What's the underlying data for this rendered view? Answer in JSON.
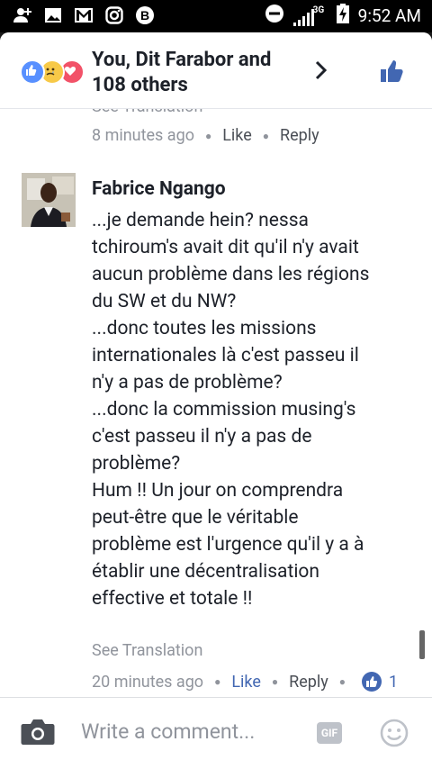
{
  "status_bar": {
    "time": "9:52 AM",
    "network_label": "3G",
    "left_icons": [
      "user-add-icon",
      "gallery-icon",
      "gmail-icon",
      "instagram-icon",
      "bitcoin-icon"
    ]
  },
  "header": {
    "title_line1": "You, Dit Farabor and",
    "title_line2": "108 others",
    "reaction_icons": [
      "like-reaction-icon",
      "sad-reaction-icon",
      "love-reaction-icon"
    ]
  },
  "previous_comment": {
    "translation_label": "See Translation",
    "time": "8 minutes ago",
    "like_label": "Like",
    "reply_label": "Reply"
  },
  "comment": {
    "author": "Fabrice Ngango",
    "lines": [
      "...je demande hein? nessa",
      "tchiroum's avait dit qu'il n'y avait",
      "aucun problème dans les régions",
      "du SW et du NW?",
      "...donc toutes les missions",
      "internationales là c'est passeu il",
      "n'y a pas de problème?",
      "...donc la commission musing's",
      "c'est passeu il n'y a pas de",
      "problème?",
      "Hum !! Un jour on comprendra",
      "peut-être que le véritable",
      "problème est l'urgence qu'il y a à",
      "établir une décentralisation",
      "effective et totale !!"
    ],
    "translation_label": "See Translation",
    "time": "20 minutes ago",
    "like_label": "Like",
    "reply_label": "Reply",
    "like_count": "1"
  },
  "composer": {
    "placeholder": "Write a comment...",
    "gif_label": "GIF"
  },
  "colors": {
    "accent": "#4267b2",
    "text_primary": "#1d2129",
    "text_secondary": "#90949c"
  }
}
